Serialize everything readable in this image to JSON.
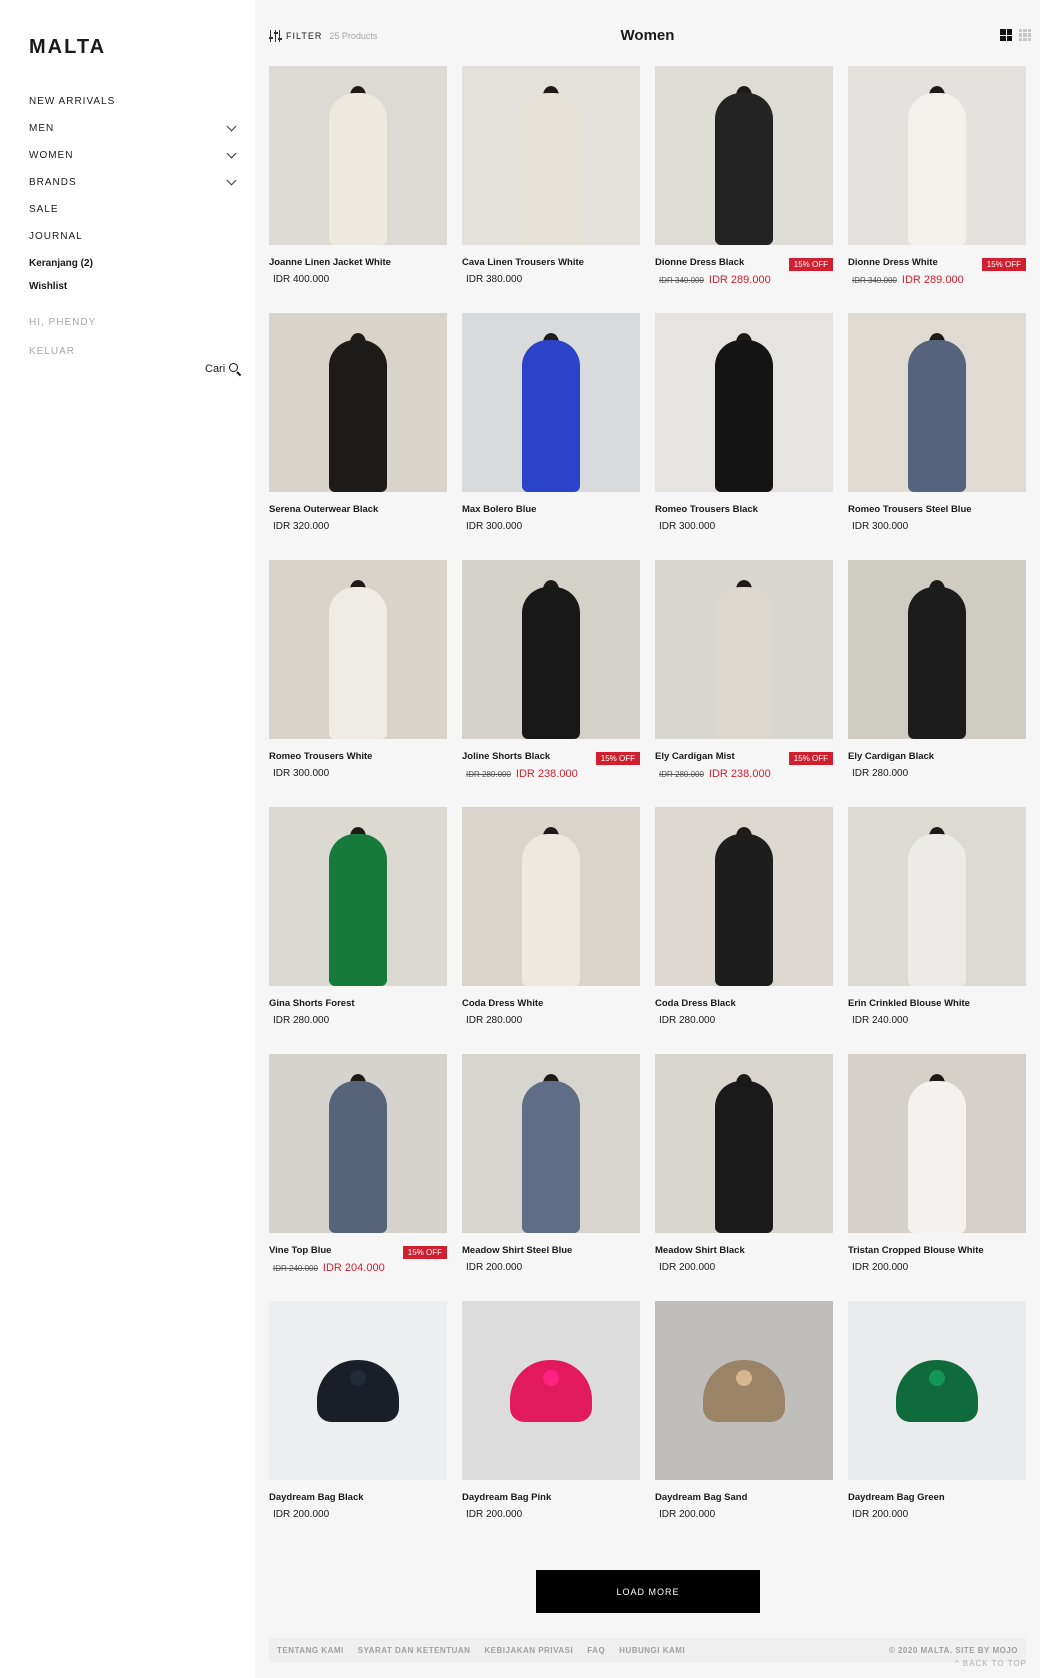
{
  "sidebar": {
    "logo": "MALTA",
    "nav": [
      {
        "label": "NEW ARRIVALS",
        "has_submenu": false
      },
      {
        "label": "MEN",
        "has_submenu": true
      },
      {
        "label": "WOMEN",
        "has_submenu": true
      },
      {
        "label": "BRANDS",
        "has_submenu": true
      },
      {
        "label": "SALE",
        "has_submenu": false
      },
      {
        "label": "JOURNAL",
        "has_submenu": false
      }
    ],
    "cart": "Keranjang (2)",
    "wishlist": "Wishlist",
    "greeting": "HI, PHENDY",
    "logout": "KELUAR",
    "search_label": "Cari",
    "search_icon": "search-icon"
  },
  "header": {
    "filter_label": "FILTER",
    "product_count": "25 Products",
    "title": "Women"
  },
  "products": [
    {
      "name": "Joanne Linen Jacket White",
      "price": "IDR 400.000",
      "bg": "#dcdad5",
      "figure": "#ede9df",
      "kind": "person"
    },
    {
      "name": "Cava Linen Trousers White",
      "price": "IDR 380.000",
      "bg": "#e2e1dc",
      "figure": "#e5e1d5",
      "kind": "person"
    },
    {
      "name": "Dionne Dress Black",
      "old_price": "IDR 340.000",
      "sale_price": "IDR 289.000",
      "badge": "15% OFF",
      "bg": "#dedcd7",
      "figure": "#232323",
      "kind": "person"
    },
    {
      "name": "Dionne Dress White",
      "old_price": "IDR 340.000",
      "sale_price": "IDR 289.000",
      "badge": "15% OFF",
      "bg": "#e3e2de",
      "figure": "#f2f1ec",
      "kind": "person"
    },
    {
      "name": "Serena Outerwear Black",
      "price": "IDR 320.000",
      "bg": "#d8d4cc",
      "figure": "#1d1b19",
      "kind": "person"
    },
    {
      "name": "Max Bolero Blue",
      "price": "IDR 300.000",
      "bg": "#d9dadc",
      "figure": "#2a43c9",
      "kind": "person"
    },
    {
      "name": "Romeo Trousers Black",
      "price": "IDR 300.000",
      "bg": "#e6e4e0",
      "figure": "#141414",
      "kind": "person"
    },
    {
      "name": "Romeo Trousers Steel Blue",
      "price": "IDR 300.000",
      "bg": "#dfdbd3",
      "figure": "#56637c",
      "kind": "person"
    },
    {
      "name": "Romeo Trousers White",
      "price": "IDR 300.000",
      "bg": "#d9d3cb",
      "figure": "#efece6",
      "kind": "person"
    },
    {
      "name": "Joline Shorts Black",
      "old_price": "IDR 280.000",
      "sale_price": "IDR 238.000",
      "badge": "15% OFF",
      "bg": "#d5d1cb",
      "figure": "#181818",
      "kind": "person"
    },
    {
      "name": "Ely Cardigan Mist",
      "old_price": "IDR 280.000",
      "sale_price": "IDR 238.000",
      "badge": "15% OFF",
      "bg": "#d8d6d1",
      "figure": "#dcd8d0",
      "kind": "person"
    },
    {
      "name": "Ely Cardigan Black",
      "price": "IDR 280.000",
      "bg": "#cfccc4",
      "figure": "#1c1c1c",
      "kind": "person"
    },
    {
      "name": "Gina Shorts Forest",
      "price": "IDR 280.000",
      "bg": "#dcd9d3",
      "figure": "#177a3d",
      "kind": "person"
    },
    {
      "name": "Coda Dress White",
      "price": "IDR 280.000",
      "bg": "#d9d4cc",
      "figure": "#ede9e1",
      "kind": "person"
    },
    {
      "name": "Coda Dress Black",
      "price": "IDR 280.000",
      "bg": "#dcd8d1",
      "figure": "#1d1d1d",
      "kind": "person"
    },
    {
      "name": "Erin Crinkled Blouse White",
      "price": "IDR 240.000",
      "bg": "#ddd9d3",
      "figure": "#ecebe7",
      "kind": "person"
    },
    {
      "name": "Vine Top Blue",
      "old_price": "IDR 240.000",
      "sale_price": "IDR 204.000",
      "badge": "15% OFF",
      "bg": "#d6d3ce",
      "figure": "#56647a",
      "kind": "person"
    },
    {
      "name": "Meadow Shirt Steel Blue",
      "price": "IDR 200.000",
      "bg": "#d7d5d0",
      "figure": "#5f6e86",
      "kind": "person"
    },
    {
      "name": "Meadow Shirt Black",
      "price": "IDR 200.000",
      "bg": "#d9d6d0",
      "figure": "#1a1a1a",
      "kind": "person"
    },
    {
      "name": "Tristan Cropped Blouse White",
      "price": "IDR 200.000",
      "bg": "#d5d1ca",
      "figure": "#f3f2ee",
      "kind": "person"
    },
    {
      "name": "Daydream Bag Black",
      "price": "IDR 200.000",
      "bg": "#eceef0",
      "figure": "#1a1e26",
      "kind": "bag"
    },
    {
      "name": "Daydream Bag Pink",
      "price": "IDR 200.000",
      "bg": "#dcdcdc",
      "figure": "#e2195c",
      "kind": "bag"
    },
    {
      "name": "Daydream Bag Sand",
      "price": "IDR 200.000",
      "bg": "#bfbebb",
      "figure": "#9a8366",
      "kind": "bag"
    },
    {
      "name": "Daydream Bag Green",
      "price": "IDR 200.000",
      "bg": "#e9ebec",
      "figure": "#0f6b3c",
      "kind": "bag"
    }
  ],
  "load_more": "LOAD MORE",
  "footer": {
    "links": [
      "TENTANG KAMI",
      "SYARAT DAN KETENTUAN",
      "KEBIJAKAN PRIVASI",
      "FAQ",
      "HUBUNGI KAMI"
    ],
    "copyright": "© 2020 MALTA. SITE BY MOJO",
    "back_to_top": "^ BACK TO TOP"
  }
}
